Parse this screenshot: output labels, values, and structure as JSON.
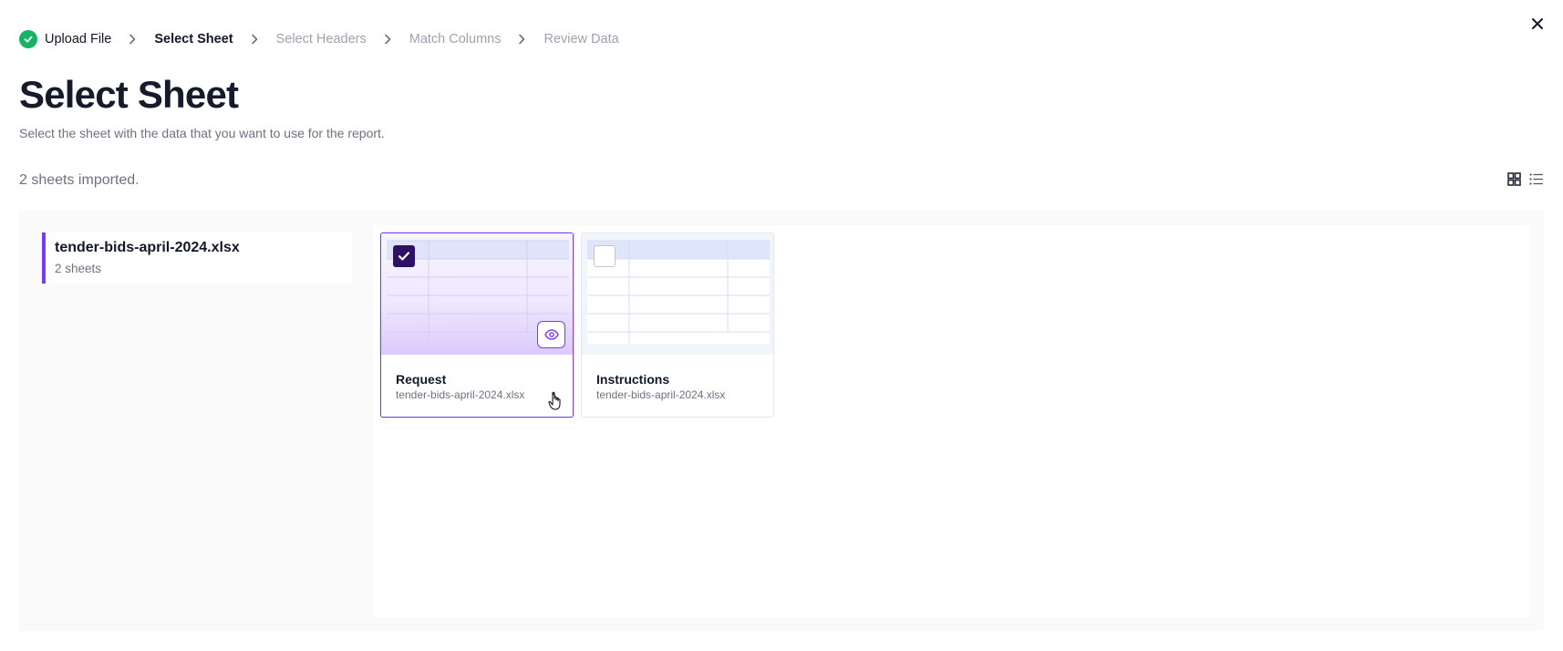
{
  "stepper": {
    "steps": [
      {
        "label": "Upload File",
        "state": "done"
      },
      {
        "label": "Select Sheet",
        "state": "current"
      },
      {
        "label": "Select Headers",
        "state": "todo"
      },
      {
        "label": "Match Columns",
        "state": "todo"
      },
      {
        "label": "Review Data",
        "state": "todo"
      }
    ]
  },
  "page": {
    "title": "Select Sheet",
    "subtitle": "Select the sheet with the data that you want to use for the report.",
    "imported_count": "2 sheets imported."
  },
  "files": [
    {
      "name": "tender-bids-april-2024.xlsx",
      "meta": "2 sheets"
    }
  ],
  "sheets": [
    {
      "name": "Request",
      "file": "tender-bids-april-2024.xlsx",
      "selected": true
    },
    {
      "name": "Instructions",
      "file": "tender-bids-april-2024.xlsx",
      "selected": false
    }
  ],
  "icons": {
    "close": "close-icon",
    "step_done": "check-circle-icon",
    "separator": "chevron-right-icon",
    "view_grid": "grid-view-icon",
    "view_list": "list-view-icon",
    "preview": "eye-icon",
    "checkbox": "check-icon"
  },
  "colors": {
    "accent": "#7c3aed",
    "checkbox_checked": "#2e1065",
    "success": "#16b364",
    "muted_text": "#6b7280"
  }
}
